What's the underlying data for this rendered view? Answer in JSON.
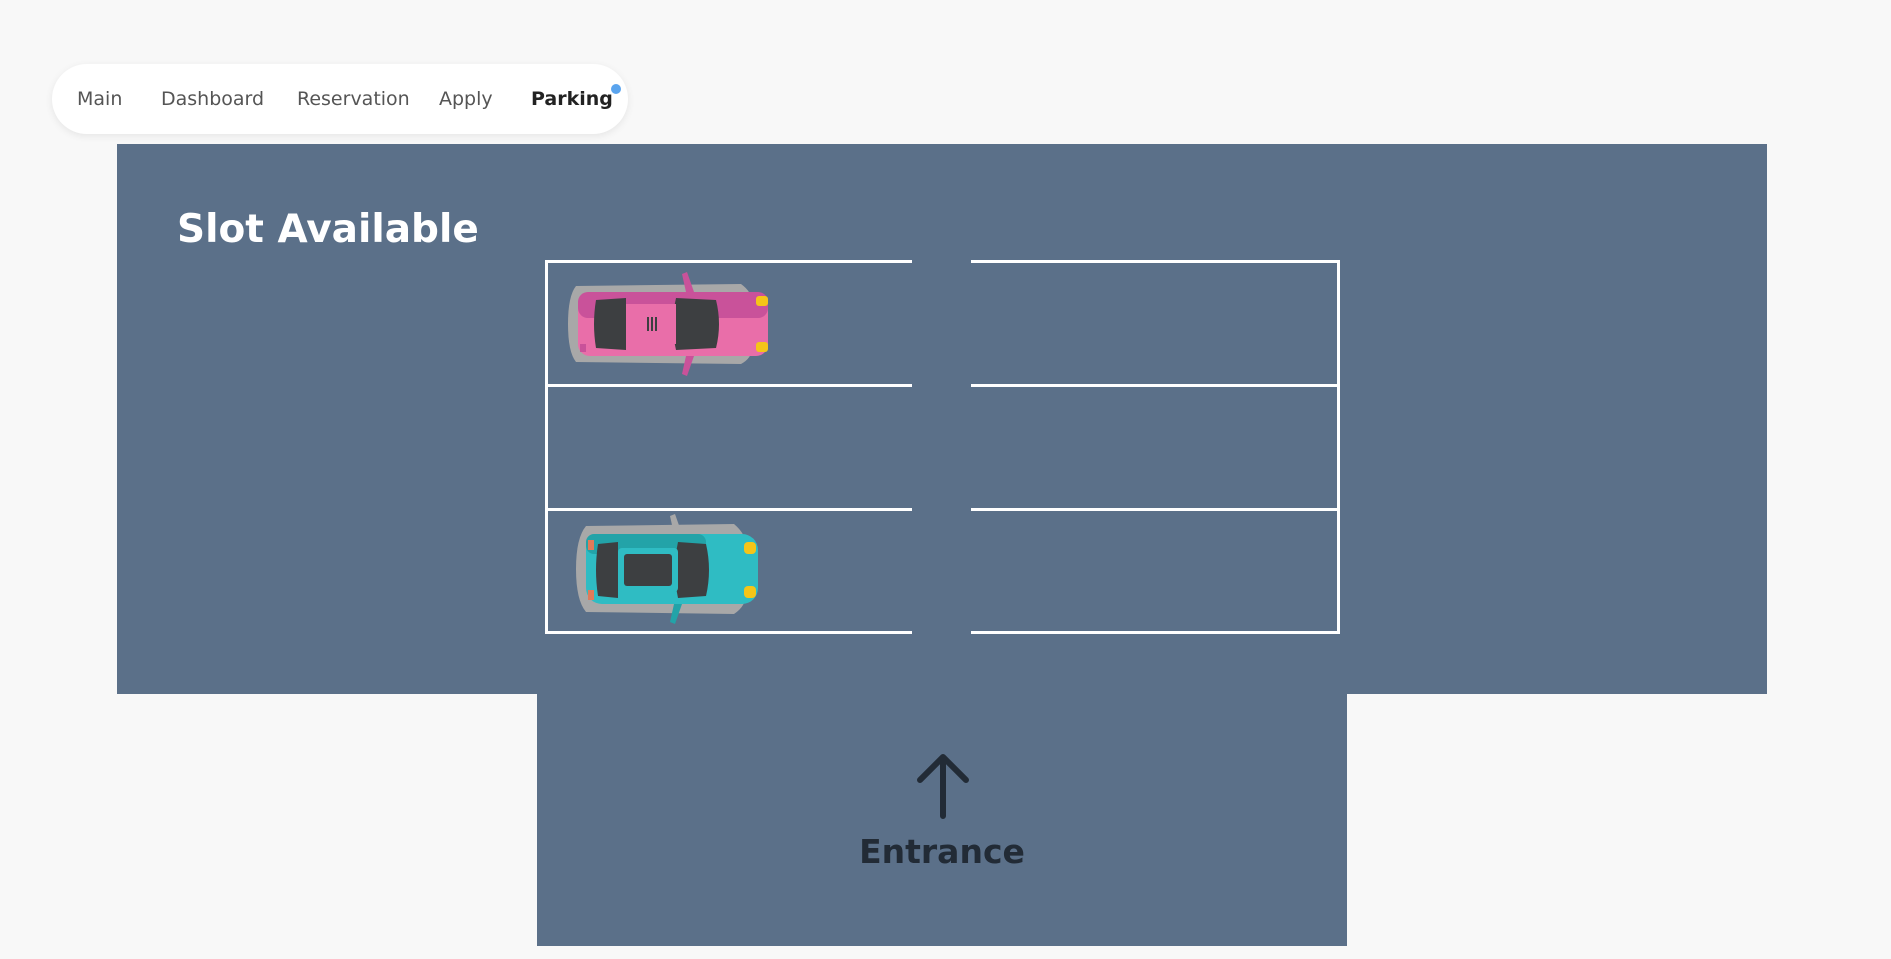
{
  "nav": {
    "items": [
      {
        "label": "Main"
      },
      {
        "label": "Dashboard"
      },
      {
        "label": "Reservation"
      },
      {
        "label": "Apply"
      },
      {
        "label": "Parking"
      }
    ],
    "active_item": "Parking",
    "indicator_color": "#5aa4ee"
  },
  "lot": {
    "title": "Slot Available",
    "entrance_label": "Entrance",
    "arrow_icon": "arrow-up-icon",
    "background_color": "#5b7089",
    "line_color": "#ffffff",
    "slots": [
      {
        "row": 1,
        "side": "left",
        "occupied": true,
        "car_color": "pink"
      },
      {
        "row": 1,
        "side": "right",
        "occupied": false
      },
      {
        "row": 2,
        "side": "left",
        "occupied": false
      },
      {
        "row": 2,
        "side": "right",
        "occupied": false
      },
      {
        "row": 3,
        "side": "left",
        "occupied": true,
        "car_color": "teal"
      },
      {
        "row": 3,
        "side": "right",
        "occupied": false
      }
    ]
  }
}
